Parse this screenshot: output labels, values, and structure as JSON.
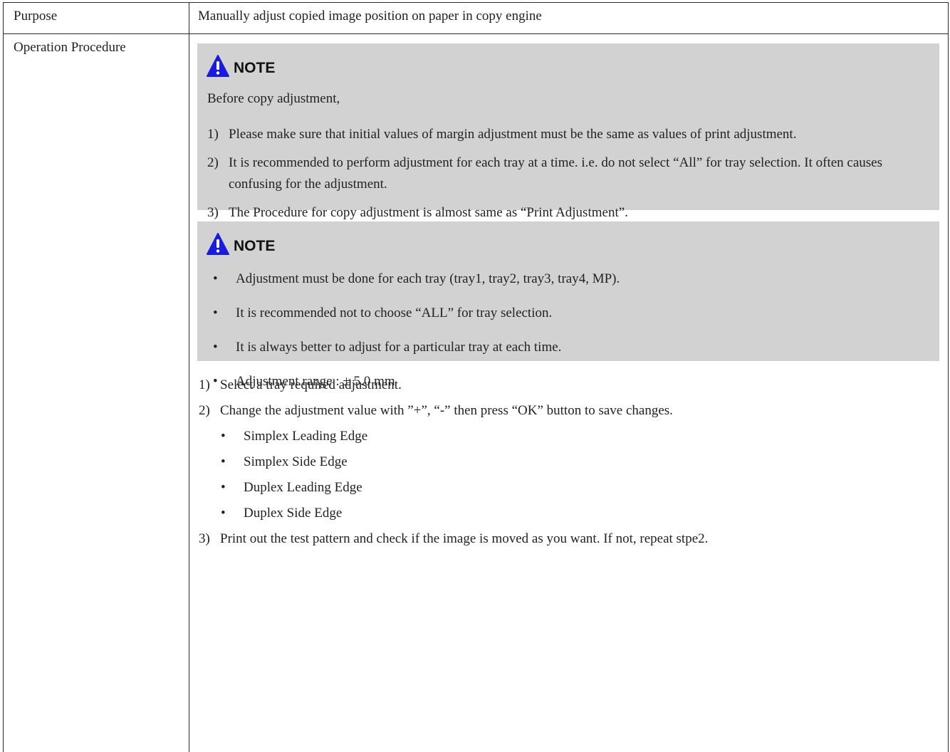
{
  "purpose": {
    "label": "Purpose",
    "value": "Manually adjust copied image position on paper in copy engine"
  },
  "operation": {
    "label": "Operation Procedure",
    "note1": {
      "title": "NOTE",
      "intro": "Before copy adjustment,",
      "items": [
        {
          "num": "1)",
          "text": "Please make sure that initial values of margin adjustment must be the same as values of print adjustment."
        },
        {
          "num": "2)",
          "text": "It is recommended to perform adjustment for each tray at a time. i.e. do not select “All” for tray selection. It often causes confusing for the adjustment."
        },
        {
          "num": "3)",
          "text": "The Procedure for copy adjustment is almost same as “Print Adjustment”."
        }
      ]
    },
    "note2": {
      "title": "NOTE",
      "bullets": [
        "Adjustment must be done for each tray (tray1, tray2, tray3, tray4, MP).",
        "It is recommended not to choose “ALL” for tray selection.",
        "It is always better to adjust for a particular tray at each time.",
        "Adjustment range : ± 5.0 mm"
      ]
    },
    "steps": [
      {
        "num": "1)",
        "text": "Select a tray required adjustment."
      },
      {
        "num": "2)",
        "text": "Change the adjustment value with ”+”, “-” then press “OK” button to save changes."
      },
      {
        "num": "3)",
        "text": "Print out the test pattern and check if the image is moved as you want. If not, repeat stpe2."
      }
    ],
    "sub_items": [
      "Simplex Leading Edge",
      "Simplex Side Edge",
      "Duplex Leading Edge",
      "Duplex Side Edge"
    ]
  },
  "icons": {
    "warning_fill": "#1a1ae0",
    "note_background": "#d2d2d2"
  }
}
